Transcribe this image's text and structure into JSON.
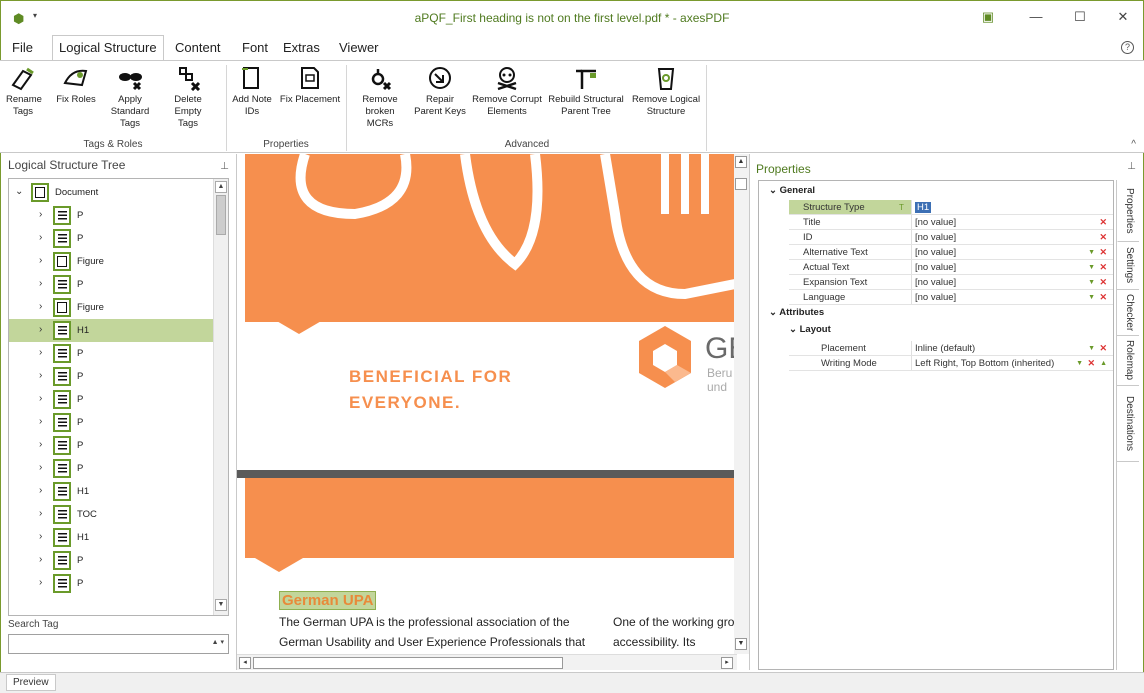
{
  "window": {
    "title": "aPQF_First heading is not on the first level.pdf * - axesPDF",
    "controls": {
      "restore": "▣",
      "minimize": "—",
      "maximize": "☐",
      "close": "✕"
    }
  },
  "menu": {
    "tabs": [
      "File",
      "Logical Structure",
      "Content",
      "Font",
      "Extras",
      "Viewer"
    ],
    "active": "Logical Structure",
    "help": "?"
  },
  "ribbon": {
    "groups": {
      "tags_roles": "Tags & Roles",
      "properties": "Properties",
      "advanced": "Advanced"
    },
    "buttons": {
      "rename_tags": "Rename Tags",
      "fix_roles": "Fix Roles",
      "apply_standard_tags": "Apply Standard Tags",
      "delete_empty_tags": "Delete Empty Tags",
      "add_note_ids": "Add Note IDs",
      "fix_placement": "Fix Placement",
      "remove_broken_mcrs": "Remove broken MCRs",
      "repair_parent_keys": "Repair Parent Keys",
      "remove_corrupt_elements": "Remove Corrupt Elements",
      "rebuild_structural_parent_tree": "Rebuild Structural Parent Tree",
      "remove_logical_structure": "Remove Logical Structure"
    },
    "collapse": "^"
  },
  "left_panel": {
    "title": "Logical Structure Tree",
    "tree": [
      {
        "label": "Document",
        "icon": "document-icon",
        "expanded": true
      },
      {
        "label": "P",
        "icon": "paragraph-icon"
      },
      {
        "label": "P",
        "icon": "paragraph-icon"
      },
      {
        "label": "Figure",
        "icon": "figure-icon"
      },
      {
        "label": "P",
        "icon": "paragraph-icon"
      },
      {
        "label": "Figure",
        "icon": "figure-icon"
      },
      {
        "label": "H1",
        "icon": "heading-icon",
        "selected": true
      },
      {
        "label": "P",
        "icon": "paragraph-icon"
      },
      {
        "label": "P",
        "icon": "paragraph-icon"
      },
      {
        "label": "P",
        "icon": "paragraph-icon"
      },
      {
        "label": "P",
        "icon": "paragraph-icon"
      },
      {
        "label": "P",
        "icon": "paragraph-icon"
      },
      {
        "label": "P",
        "icon": "paragraph-icon"
      },
      {
        "label": "H1",
        "icon": "heading-icon"
      },
      {
        "label": "TOC",
        "icon": "toc-icon"
      },
      {
        "label": "H1",
        "icon": "heading-icon"
      },
      {
        "label": "P",
        "icon": "paragraph-icon"
      },
      {
        "label": "P",
        "icon": "paragraph-icon"
      }
    ],
    "search_label": "Search Tag",
    "search_value": ""
  },
  "document": {
    "beneficial_line1": "BENEFICIAL FOR",
    "beneficial_line2": "EVERYONE.",
    "logo_text": "GE",
    "logo_sub1": "Beru",
    "logo_sub2": "und",
    "heading": "German UPA",
    "col1_line1": "The German UPA is the professional association of the",
    "col1_line2": "German Usability and User Experience Professionals that",
    "col2_line1": "One of the working gro",
    "col2_line2": "accessibility. Its membe"
  },
  "properties": {
    "title": "Properties",
    "sections": {
      "general": "General",
      "attributes": "Attributes",
      "layout": "Layout"
    },
    "rows": [
      {
        "name": "Structure Type",
        "value": "H1"
      },
      {
        "name": "Title",
        "value": "[no value]"
      },
      {
        "name": "ID",
        "value": "[no value]"
      },
      {
        "name": "Alternative Text",
        "value": "[no value]"
      },
      {
        "name": "Actual Text",
        "value": "[no value]"
      },
      {
        "name": "Expansion Text",
        "value": "[no value]"
      },
      {
        "name": "Language",
        "value": "[no value]"
      }
    ],
    "layout_rows": [
      {
        "name": "Placement",
        "value": "Inline (default)"
      },
      {
        "name": "Writing Mode",
        "value": "Left Right, Top Bottom (inherited)"
      }
    ],
    "side_tabs": [
      "Properties",
      "Settings",
      "Checker",
      "Rolemap",
      "Destinations"
    ]
  },
  "status": {
    "preview_tab": "Preview"
  },
  "colors": {
    "accent": "#6a9a2a",
    "selection": "#c2d69b",
    "orange": "#f68f4e"
  }
}
